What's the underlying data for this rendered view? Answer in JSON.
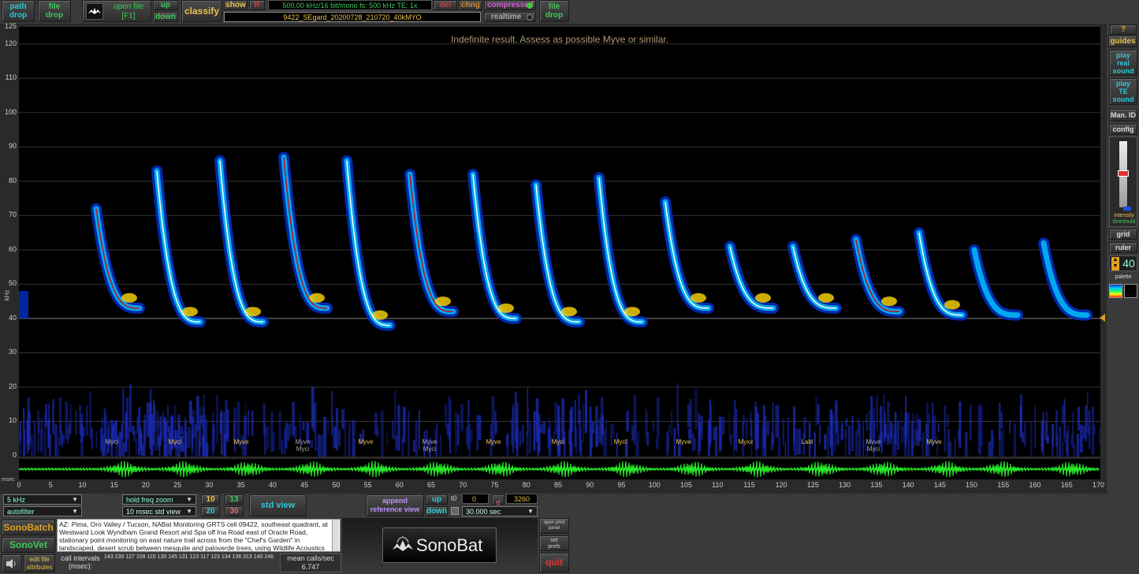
{
  "top": {
    "path_drop": [
      "path",
      "drop"
    ],
    "file_drop_left": [
      "file",
      "drop"
    ],
    "open_file": [
      "open file",
      "[F1]"
    ],
    "up": "up",
    "down": "down",
    "classify": "classify",
    "show": "show",
    "r": "R",
    "format_info": "500.00 kHz/16 bit/mono   fs: 500 kHz   TE:  1x",
    "filename": "9422_SEgard_20200728_210720_40kMYO",
    "del": "del",
    "chng": "chng",
    "compressed": "compressed",
    "realtime": "realtime",
    "file_drop_right": [
      "file",
      "drop"
    ]
  },
  "spectrogram": {
    "result_text": "Indefinite result. Assess as possible Myve or similar.",
    "y_unit": "kHz",
    "y_ticks": [
      "125",
      "120",
      "110",
      "100",
      "90",
      "80",
      "70",
      "60",
      "50",
      "40",
      "30",
      "20",
      "10",
      "0"
    ],
    "x_unit": "msec",
    "x_ticks": [
      "0",
      "5",
      "10",
      "15",
      "20",
      "25",
      "30",
      "35",
      "40",
      "45",
      "50",
      "55",
      "60",
      "65",
      "70",
      "75",
      "80",
      "85",
      "90",
      "95",
      "100",
      "105",
      "110",
      "115",
      "120",
      "125",
      "130",
      "135",
      "140",
      "145",
      "150",
      "155",
      "160",
      "165",
      "170"
    ],
    "call_labels": [
      {
        "l1": "Myci",
        "l2": "",
        "hl": false
      },
      {
        "l1": "Myci",
        "l2": "",
        "hl": true
      },
      {
        "l1": "Myve",
        "l2": "",
        "hl": true
      },
      {
        "l1": "Myve",
        "l2": "Myci",
        "hl": false
      },
      {
        "l1": "Myve",
        "l2": "",
        "hl": true
      },
      {
        "l1": "Myve",
        "l2": "Myci",
        "hl": false
      },
      {
        "l1": "Myve",
        "l2": "",
        "hl": true
      },
      {
        "l1": "Myci",
        "l2": "",
        "hl": true
      },
      {
        "l1": "Myci",
        "l2": "",
        "hl": true
      },
      {
        "l1": "Myve",
        "l2": "",
        "hl": true
      },
      {
        "l1": "Myxx",
        "l2": "",
        "hl": true
      },
      {
        "l1": "Labl",
        "l2": "",
        "hl": true
      },
      {
        "l1": "Myve",
        "l2": "Myci",
        "hl": false
      },
      {
        "l1": "Myve",
        "l2": "",
        "hl": true
      }
    ],
    "colors": {
      "bg": "#000000",
      "trace": "#ffffff",
      "core": "#ffd800",
      "mid": "#00c8ff",
      "outer": "#0030c8",
      "noise": "#1a2ab0",
      "wave": "#2cff2c",
      "pointer": "#e0a020"
    }
  },
  "right_panel": {
    "guides": "guides",
    "play_real": [
      "play",
      "real",
      "sound"
    ],
    "play_te": [
      "play",
      "TE",
      "sound"
    ],
    "man_id": "Man. ID",
    "config": "config",
    "intensity": [
      "intensity",
      "threshold"
    ],
    "grid": "grid",
    "ruler": "ruler",
    "ruler_value": "40",
    "palette": "palette",
    "help": "?"
  },
  "bottom": {
    "freq_select": "5 kHz",
    "filter_select": "autofilter",
    "hold_freq_zoom": "hold freq zoom",
    "std_view_select": "10 msec std view",
    "num_10": "10",
    "num_13": "13",
    "num_20": "20",
    "num_30": "30",
    "std_view": "std view",
    "append_ref": [
      "append",
      "reference view"
    ],
    "up": "up",
    "down": "down",
    "t0_label": "t0",
    "t0_value": "0",
    "tf_label": "tf",
    "tf_value": "3260",
    "duration": "30.000 sec",
    "sonobatch": "SonoBatch",
    "sonovet": "SonoVet",
    "edit_file": [
      "edit file",
      "attributes"
    ],
    "notes": "AZ: Pima, Oro Valley / Tucson, NABat Monitoring GRTS cell 09422, southeast quadrant, at Westward Look Wyndham Grand Resort and Spa off Ina Road east of Oracle Road, stationary point monitoring on east nature trail across from the \"Chef's Garden\" in landscaped, desert scrub between mesquite and paloverde trees, using Wildlife Acoustics",
    "call_intervals_label": [
      "call intervals",
      "(msec):"
    ],
    "call_intervals": "143 239 127 109 115 130 145 131 123 117 123 134 136 313 140 246",
    "mean_calls_label": "mean calls/sec",
    "mean_calls_value": "6.747",
    "logo": "SonoBat",
    "open_print": [
      "open print",
      "panel"
    ],
    "set_prefs": [
      "set",
      "prefs"
    ],
    "quit": "quit"
  }
}
